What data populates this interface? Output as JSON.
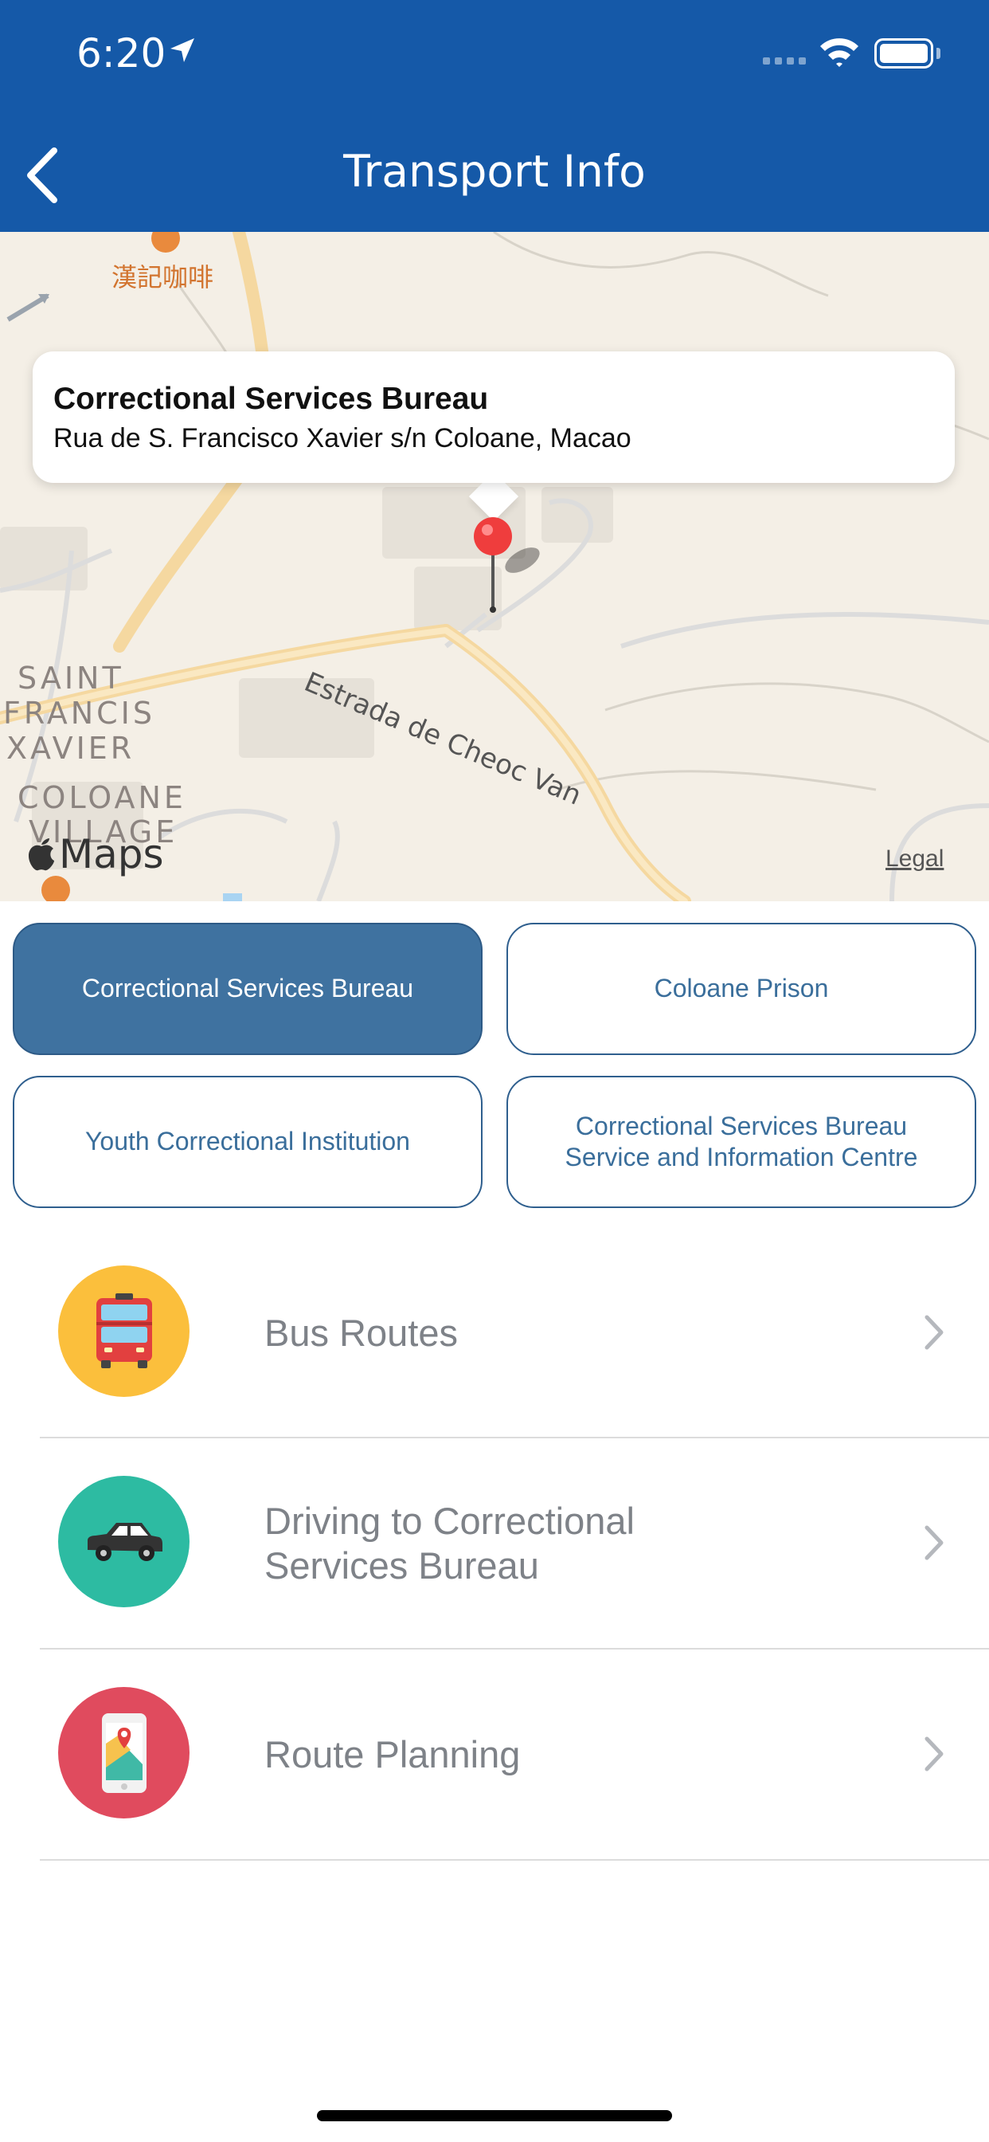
{
  "status_bar": {
    "time": "6:20"
  },
  "nav": {
    "title": "Transport Info",
    "back_icon": "chevron-left-icon"
  },
  "map": {
    "callout_title": "Correctional Services Bureau",
    "callout_address": "Rua de S. Francisco Xavier s/n Coloane, Macao",
    "road_label": "Estrada de Cheoc Van",
    "area_labels": [
      "SAINT",
      "FRANCIS",
      "XAVIER",
      "COLOANE",
      "VILLAGE"
    ],
    "poi_label": "漢記咖啡",
    "maps_logo": "Maps",
    "legal": "Legal"
  },
  "tabs": [
    {
      "label": "Correctional Services Bureau",
      "selected": true
    },
    {
      "label": "Coloane Prison",
      "selected": false
    },
    {
      "label": "Youth Correctional Institution",
      "selected": false
    },
    {
      "label": "Correctional Services Bureau Service and Information Centre",
      "selected": false
    }
  ],
  "list": [
    {
      "label": "Bus Routes",
      "icon": "bus-icon",
      "color": "#fbbf3c"
    },
    {
      "label": "Driving to Correctional Services Bureau",
      "icon": "car-icon",
      "color": "#2dbba2"
    },
    {
      "label": "Route Planning",
      "icon": "phone-map-icon",
      "color": "#e04b5e"
    }
  ],
  "colors": {
    "header": "#1559a8",
    "tab_active": "#3f72a0",
    "tab_text": "#3a6e9b"
  }
}
